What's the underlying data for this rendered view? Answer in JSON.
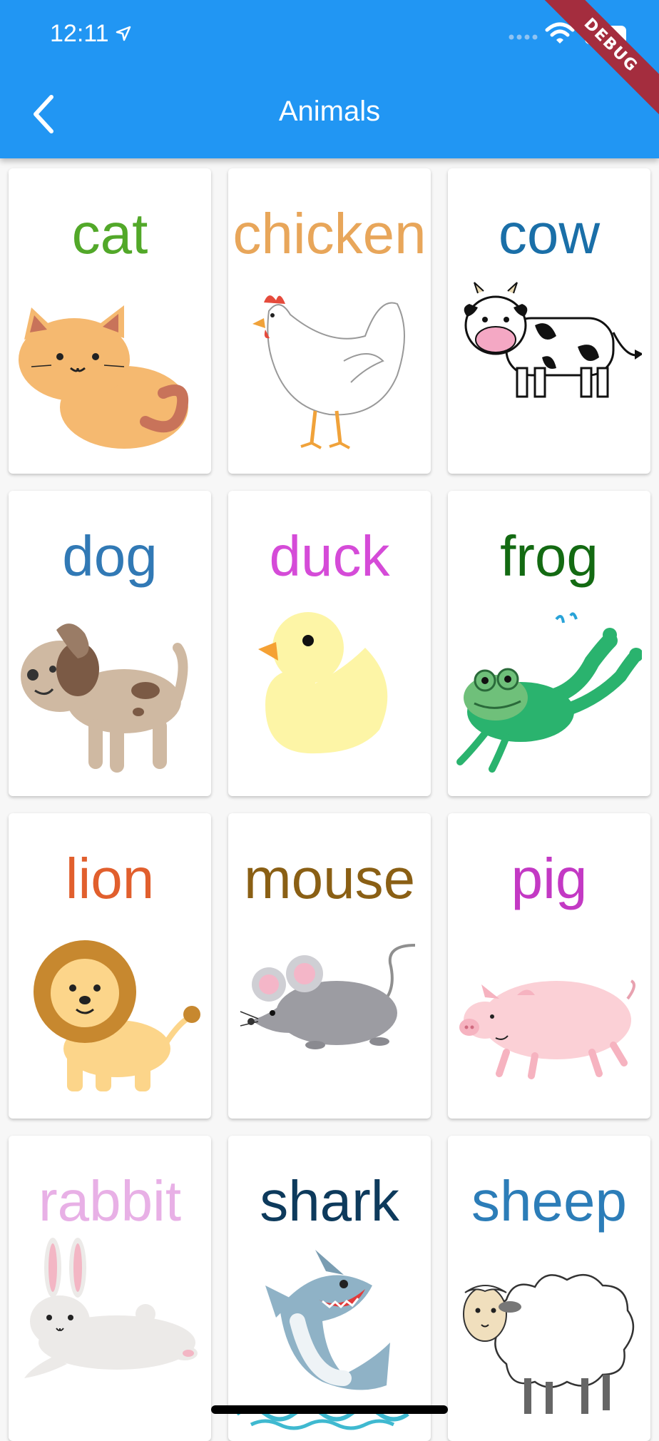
{
  "status_bar": {
    "time": "12:11"
  },
  "app_bar": {
    "title": "Animals",
    "banner": "DEBUG"
  },
  "animals": [
    {
      "name": "cat",
      "color": "#52a829"
    },
    {
      "name": "chicken",
      "color": "#e8a65a"
    },
    {
      "name": "cow",
      "color": "#1a6fa8"
    },
    {
      "name": "dog",
      "color": "#3179b5"
    },
    {
      "name": "duck",
      "color": "#d54bd8"
    },
    {
      "name": "frog",
      "color": "#136a12"
    },
    {
      "name": "lion",
      "color": "#e15f2d"
    },
    {
      "name": "mouse",
      "color": "#8a5f14"
    },
    {
      "name": "pig",
      "color": "#c339c4"
    },
    {
      "name": "rabbit",
      "color": "#e8b0e6"
    },
    {
      "name": "shark",
      "color": "#0d3a5c"
    },
    {
      "name": "sheep",
      "color": "#2c7db8"
    }
  ]
}
